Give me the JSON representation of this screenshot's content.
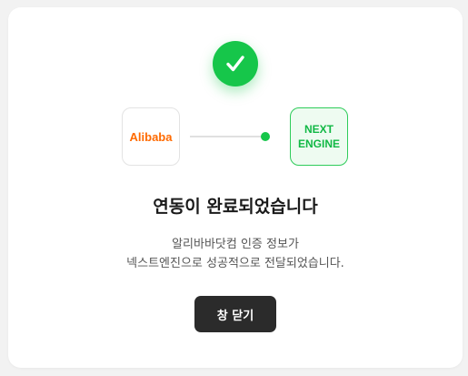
{
  "success_icon": "check-icon",
  "colors": {
    "success_green": "#16c64a",
    "alibaba_orange": "#ff6a00",
    "button_dark": "#2b2b2b"
  },
  "source_logo": {
    "text": "Alibaba"
  },
  "target_logo": {
    "line1": "NEXT",
    "line2": "ENGINE"
  },
  "title": "연동이 완료되었습니다",
  "description": {
    "line1": "알리바바닷컴 인증 정보가",
    "line2": "넥스트엔진으로 성공적으로 전달되었습니다."
  },
  "close_button_label": "창 닫기"
}
